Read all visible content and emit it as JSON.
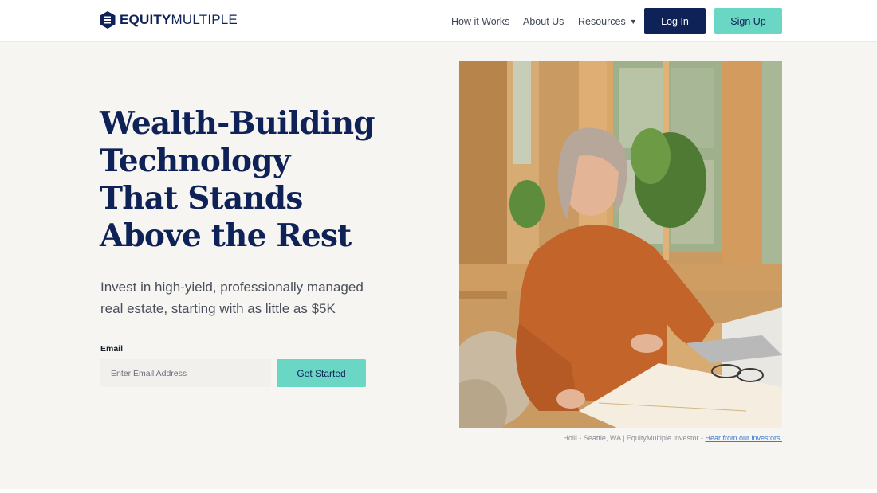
{
  "header": {
    "logo": {
      "text_bold": "EQUITY",
      "text_light": "MULTIPLE"
    },
    "nav": [
      {
        "label": "How it Works"
      },
      {
        "label": "About Us"
      },
      {
        "label": "Resources"
      }
    ],
    "login_label": "Log In",
    "signup_label": "Sign Up"
  },
  "hero": {
    "title_lines": [
      "Wealth-Building",
      "Technology",
      "That Stands",
      "Above the Rest"
    ],
    "subtitle_line1": "Invest in high-yield, professionally managed",
    "subtitle_line2": "real estate, starting with as little as $5K",
    "email_label": "Email",
    "email_placeholder": "Enter Email Address",
    "email_value": "",
    "cta_label": "Get Started"
  },
  "photo": {
    "caption_text": "Holli - Seattle, WA | EquityMultiple Investor - ",
    "caption_link": "Hear from our investors."
  },
  "colors": {
    "navy": "#0f2257",
    "teal": "#6ad6c4",
    "background": "#f6f5f1"
  }
}
